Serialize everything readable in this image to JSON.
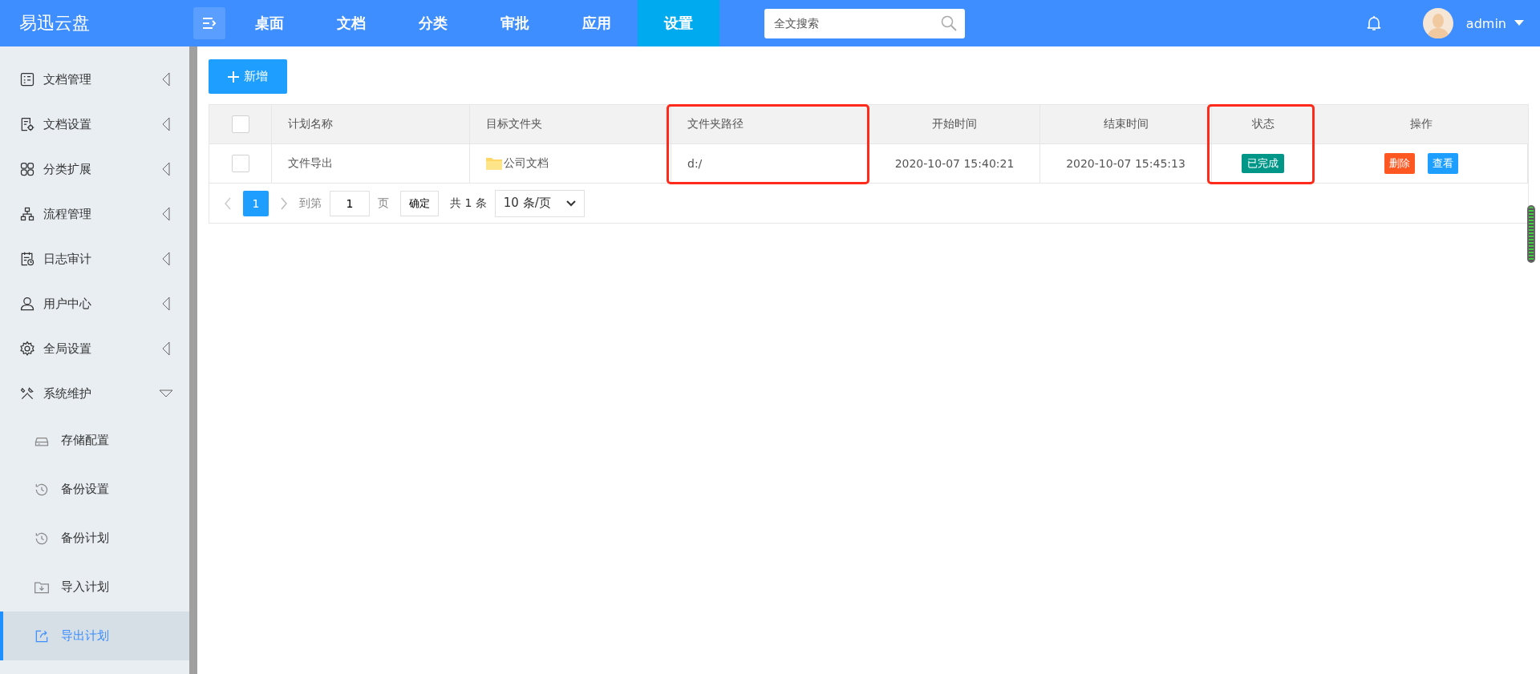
{
  "app": {
    "logo": "易迅云盘"
  },
  "nav": [
    {
      "label": "桌面",
      "selected": false
    },
    {
      "label": "文档",
      "selected": false
    },
    {
      "label": "分类",
      "selected": false
    },
    {
      "label": "审批",
      "selected": false
    },
    {
      "label": "应用",
      "selected": false
    },
    {
      "label": "设置",
      "selected": true
    }
  ],
  "search": {
    "placeholder": "全文搜索"
  },
  "user": {
    "name": "admin"
  },
  "sidebar": {
    "items": [
      {
        "label": "文档管理",
        "expanded": false
      },
      {
        "label": "文档设置",
        "expanded": false
      },
      {
        "label": "分类扩展",
        "expanded": false
      },
      {
        "label": "流程管理",
        "expanded": false
      },
      {
        "label": "日志审计",
        "expanded": false
      },
      {
        "label": "用户中心",
        "expanded": false
      },
      {
        "label": "全局设置",
        "expanded": false
      },
      {
        "label": "系统维护",
        "expanded": true,
        "children": [
          {
            "label": "存储配置",
            "selected": false
          },
          {
            "label": "备份设置",
            "selected": false
          },
          {
            "label": "备份计划",
            "selected": false
          },
          {
            "label": "导入计划",
            "selected": false
          },
          {
            "label": "导出计划",
            "selected": true
          }
        ]
      }
    ]
  },
  "toolbar": {
    "add_button": "新增"
  },
  "table": {
    "columns": [
      {
        "label": "计划名称",
        "highlighted": false
      },
      {
        "label": "目标文件夹",
        "highlighted": false
      },
      {
        "label": "文件夹路径",
        "highlighted": true
      },
      {
        "label": "开始时间",
        "highlighted": false
      },
      {
        "label": "结束时间",
        "highlighted": false
      },
      {
        "label": "状态",
        "highlighted": true
      },
      {
        "label": "操作",
        "highlighted": false
      }
    ],
    "rows": [
      {
        "checked": false,
        "name": "文件导出",
        "folder": "公司文档",
        "path": "d:/",
        "start": "2020-10-07 15:40:21",
        "end": "2020-10-07 15:45:13",
        "status": "已完成",
        "actions": [
          "删除",
          "查看"
        ]
      }
    ],
    "header_checked": false
  },
  "pagination": {
    "pages": [
      {
        "label": "1",
        "selected": true
      }
    ],
    "goto_label": "到第",
    "goto_value": "1",
    "page_unit": "页",
    "confirm": "确定",
    "total": "共 1 条",
    "page_size": "10 条/页"
  }
}
